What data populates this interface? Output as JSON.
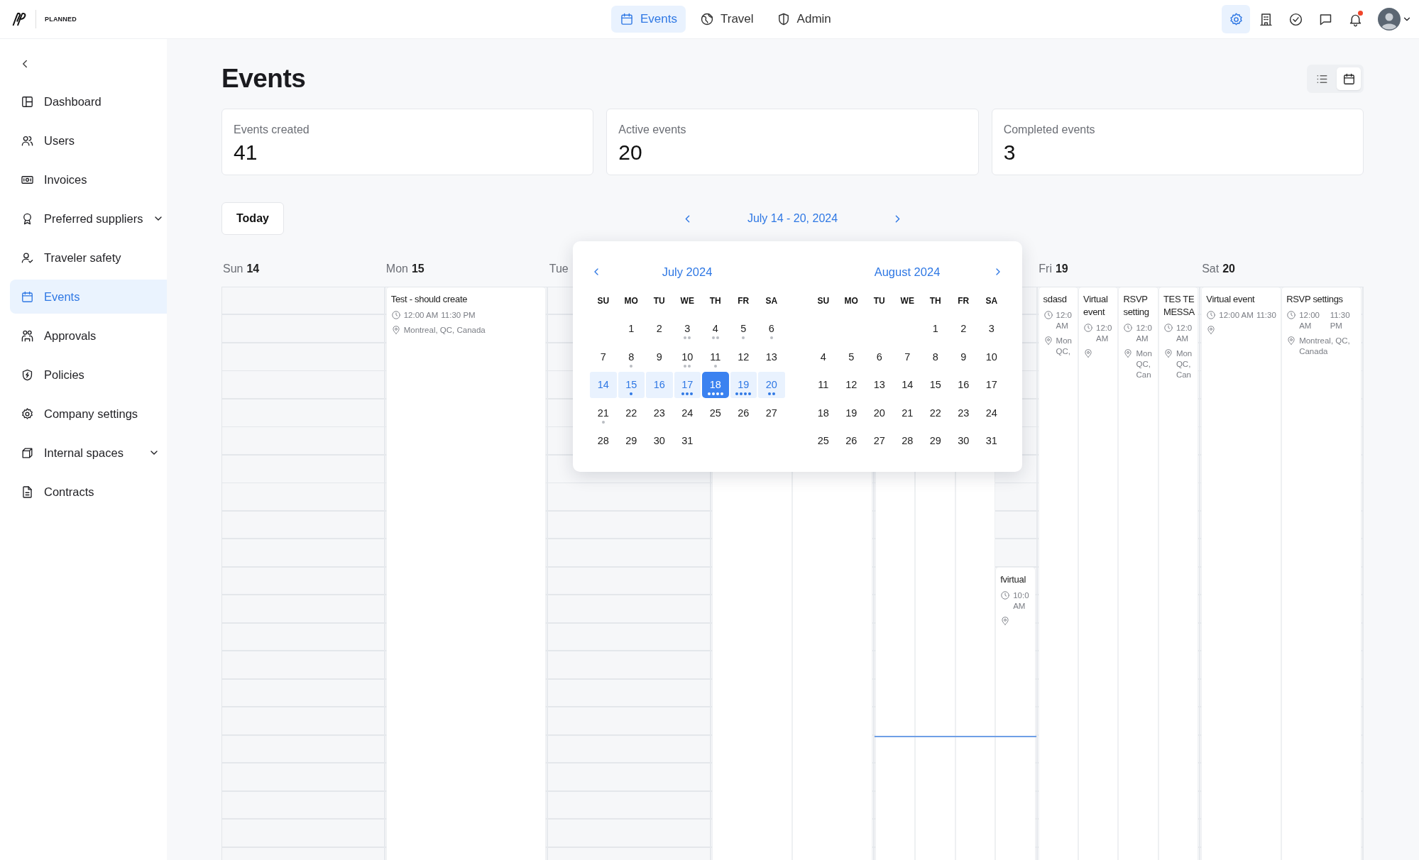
{
  "brand": {
    "wordmark": "PLANNED"
  },
  "top_nav": [
    {
      "label": "Events",
      "selected": true
    },
    {
      "label": "Travel",
      "selected": false
    },
    {
      "label": "Admin",
      "selected": false
    }
  ],
  "top_actions": [
    {
      "kind": "settings",
      "selected": true,
      "notification_dot": false
    },
    {
      "kind": "building",
      "selected": false,
      "notification_dot": false
    },
    {
      "kind": "check",
      "selected": false,
      "notification_dot": false
    },
    {
      "kind": "chat",
      "selected": false,
      "notification_dot": false
    },
    {
      "kind": "bell",
      "selected": false,
      "notification_dot": true
    }
  ],
  "sidebar": {
    "items": [
      {
        "label": "Dashboard",
        "selected": false,
        "expandable": false
      },
      {
        "label": "Users",
        "selected": false,
        "expandable": false
      },
      {
        "label": "Invoices",
        "selected": false,
        "expandable": false
      },
      {
        "label": "Preferred suppliers",
        "selected": false,
        "expandable": true
      },
      {
        "label": "Traveler safety",
        "selected": false,
        "expandable": false
      },
      {
        "label": "Events",
        "selected": true,
        "expandable": false
      },
      {
        "label": "Approvals",
        "selected": false,
        "expandable": false
      },
      {
        "label": "Policies",
        "selected": false,
        "expandable": false
      },
      {
        "label": "Company settings",
        "selected": false,
        "expandable": false
      },
      {
        "label": "Internal spaces",
        "selected": false,
        "expandable": true
      },
      {
        "label": "Contracts",
        "selected": false,
        "expandable": false
      }
    ]
  },
  "page": {
    "title": "Events",
    "views": [
      {
        "kind": "list",
        "selected": false
      },
      {
        "kind": "calendar",
        "selected": true
      }
    ]
  },
  "stats": [
    {
      "label": "Events created",
      "value": "41"
    },
    {
      "label": "Active events",
      "value": "20"
    },
    {
      "label": "Completed events",
      "value": "3"
    }
  ],
  "toolbar": {
    "today": "Today",
    "range": "July 14 - 20, 2024"
  },
  "week": {
    "days": [
      {
        "weekday": "Sun",
        "date": "14",
        "current_time": false
      },
      {
        "weekday": "Mon",
        "date": "15",
        "current_time": false,
        "events": [
          {
            "kind": "event",
            "title": "Test - should create",
            "start": "12:00 AM",
            "end": "11:30 PM",
            "has_location": true,
            "location": "Montreal, QC, Canada"
          }
        ]
      },
      {
        "weekday": "Tue",
        "current_time": false
      },
      {
        "current_time": false,
        "events": [
          {
            "kind": "covered"
          },
          {
            "kind": "covered"
          }
        ]
      },
      {
        "current_time": true,
        "events": [
          {
            "kind": "covered"
          },
          {
            "kind": "covered"
          },
          {
            "kind": "covered"
          },
          {
            "kind": "event",
            "title": "fvirtual",
            "start": "10:0 AM",
            "has_location": true
          }
        ]
      },
      {
        "weekday": "Fri",
        "date": "19",
        "current_time": false,
        "events": [
          {
            "kind": "event",
            "title": "sdasd",
            "start": "12:0 AM",
            "has_location": true,
            "location": "Mon QC,"
          },
          {
            "kind": "event",
            "title": "Virtual event",
            "start": "12:0 AM",
            "has_location": true
          },
          {
            "kind": "event",
            "title": "RSVP setting",
            "start": "12:0 AM",
            "has_location": true,
            "location": "Mon QC, Can"
          },
          {
            "kind": "event",
            "title": "TES TE MESSA",
            "start": "12:0 AM",
            "has_location": true,
            "location": "Mon QC, Can"
          }
        ]
      },
      {
        "weekday": "Sat",
        "date": "20",
        "current_time": false,
        "events": [
          {
            "kind": "event",
            "title": "Virtual event",
            "start": "12:00 AM",
            "end": "11:30",
            "has_location": true
          },
          {
            "kind": "event",
            "title": "RSVP settings",
            "start": "12:00 AM",
            "end": "11:30 PM",
            "has_location": true,
            "location": "Montreal, QC, Canada"
          }
        ]
      }
    ]
  },
  "date_picker": {
    "months": [
      {
        "title": "July 2024",
        "has_prev": true,
        "has_next": false,
        "weekdays": [
          "SU",
          "MO",
          "TU",
          "WE",
          "TH",
          "FR",
          "SA"
        ],
        "weeks": [
          {
            "days": [
              {
                "day": "1",
                "in_range": false,
                "selected": false
              },
              {
                "day": "2",
                "in_range": false,
                "selected": false
              },
              {
                "day": "3",
                "in_range": false,
                "selected": false,
                "dots": [
                  {
                    "kind": "event"
                  },
                  {
                    "kind": "event"
                  }
                ]
              },
              {
                "day": "4",
                "in_range": false,
                "selected": false,
                "dots": [
                  {
                    "kind": "event"
                  },
                  {
                    "kind": "event"
                  }
                ]
              },
              {
                "day": "5",
                "in_range": false,
                "selected": false,
                "dots": [
                  {
                    "kind": "event"
                  }
                ]
              },
              {
                "day": "6",
                "in_range": false,
                "selected": false,
                "dots": [
                  {
                    "kind": "event"
                  }
                ]
              }
            ]
          },
          {
            "days": [
              {
                "day": "7",
                "in_range": false,
                "selected": false
              },
              {
                "day": "8",
                "in_range": false,
                "selected": false,
                "dots": [
                  {
                    "kind": "event"
                  }
                ]
              },
              {
                "day": "9",
                "in_range": false,
                "selected": false
              },
              {
                "day": "10",
                "in_range": false,
                "selected": false,
                "dots": [
                  {
                    "kind": "event"
                  },
                  {
                    "kind": "event"
                  }
                ]
              },
              {
                "day": "11",
                "in_range": false,
                "selected": false,
                "dots": [
                  {
                    "kind": "event"
                  }
                ]
              },
              {
                "day": "12",
                "in_range": false,
                "selected": false
              },
              {
                "day": "13",
                "in_range": false,
                "selected": false
              }
            ]
          },
          {
            "days": [
              {
                "day": "14",
                "in_range": true,
                "selected": false
              },
              {
                "day": "15",
                "in_range": true,
                "selected": false,
                "dots": [
                  {
                    "kind": "event"
                  }
                ]
              },
              {
                "day": "16",
                "in_range": true,
                "selected": false
              },
              {
                "day": "17",
                "in_range": true,
                "selected": false,
                "dots": [
                  {
                    "kind": "event"
                  },
                  {
                    "kind": "event"
                  },
                  {
                    "kind": "event"
                  }
                ]
              },
              {
                "day": "18",
                "in_range": true,
                "selected": true,
                "dots": [
                  {
                    "kind": "event"
                  },
                  {
                    "kind": "event"
                  },
                  {
                    "kind": "event"
                  },
                  {
                    "kind": "event"
                  }
                ]
              },
              {
                "day": "19",
                "in_range": true,
                "selected": false,
                "dots": [
                  {
                    "kind": "event"
                  },
                  {
                    "kind": "event"
                  },
                  {
                    "kind": "event"
                  },
                  {
                    "kind": "event"
                  }
                ]
              },
              {
                "day": "20",
                "in_range": true,
                "selected": false,
                "dots": [
                  {
                    "kind": "event"
                  },
                  {
                    "kind": "event"
                  }
                ]
              }
            ]
          },
          {
            "days": [
              {
                "day": "21",
                "in_range": false,
                "selected": false,
                "dots": [
                  {
                    "kind": "event"
                  }
                ]
              },
              {
                "day": "22",
                "in_range": false,
                "selected": false
              },
              {
                "day": "23",
                "in_range": false,
                "selected": false
              },
              {
                "day": "24",
                "in_range": false,
                "selected": false
              },
              {
                "day": "25",
                "in_range": false,
                "selected": false
              },
              {
                "day": "26",
                "in_range": false,
                "selected": false
              },
              {
                "day": "27",
                "in_range": false,
                "selected": false
              }
            ]
          },
          {
            "days": [
              {
                "day": "28",
                "in_range": false,
                "selected": false
              },
              {
                "day": "29",
                "in_range": false,
                "selected": false
              },
              {
                "day": "30",
                "in_range": false,
                "selected": false
              },
              {
                "day": "31",
                "in_range": false,
                "selected": false
              }
            ]
          }
        ]
      },
      {
        "title": "August 2024",
        "has_prev": false,
        "has_next": true,
        "weekdays": [
          "SU",
          "MO",
          "TU",
          "WE",
          "TH",
          "FR",
          "SA"
        ],
        "weeks": [
          {
            "days": [
              {
                "day": "1",
                "in_range": false,
                "selected": false
              },
              {
                "day": "2",
                "in_range": false,
                "selected": false
              },
              {
                "day": "3",
                "in_range": false,
                "selected": false
              }
            ]
          },
          {
            "days": [
              {
                "day": "4",
                "in_range": false,
                "selected": false
              },
              {
                "day": "5",
                "in_range": false,
                "selected": false
              },
              {
                "day": "6",
                "in_range": false,
                "selected": false
              },
              {
                "day": "7",
                "in_range": false,
                "selected": false
              },
              {
                "day": "8",
                "in_range": false,
                "selected": false
              },
              {
                "day": "9",
                "in_range": false,
                "selected": false
              },
              {
                "day": "10",
                "in_range": false,
                "selected": false
              }
            ]
          },
          {
            "days": [
              {
                "day": "11",
                "in_range": false,
                "selected": false
              },
              {
                "day": "12",
                "in_range": false,
                "selected": false
              },
              {
                "day": "13",
                "in_range": false,
                "selected": false
              },
              {
                "day": "14",
                "in_range": false,
                "selected": false
              },
              {
                "day": "15",
                "in_range": false,
                "selected": false
              },
              {
                "day": "16",
                "in_range": false,
                "selected": false
              },
              {
                "day": "17",
                "in_range": false,
                "selected": false
              }
            ]
          },
          {
            "days": [
              {
                "day": "18",
                "in_range": false,
                "selected": false
              },
              {
                "day": "19",
                "in_range": false,
                "selected": false
              },
              {
                "day": "20",
                "in_range": false,
                "selected": false
              },
              {
                "day": "21",
                "in_range": false,
                "selected": false
              },
              {
                "day": "22",
                "in_range": false,
                "selected": false
              },
              {
                "day": "23",
                "in_range": false,
                "selected": false
              },
              {
                "day": "24",
                "in_range": false,
                "selected": false
              }
            ]
          },
          {
            "days": [
              {
                "day": "25",
                "in_range": false,
                "selected": false
              },
              {
                "day": "26",
                "in_range": false,
                "selected": false
              },
              {
                "day": "27",
                "in_range": false,
                "selected": false
              },
              {
                "day": "28",
                "in_range": false,
                "selected": false
              },
              {
                "day": "29",
                "in_range": false,
                "selected": false
              },
              {
                "day": "30",
                "in_range": false,
                "selected": false
              },
              {
                "day": "31",
                "in_range": false,
                "selected": false
              }
            ]
          }
        ]
      }
    ]
  }
}
